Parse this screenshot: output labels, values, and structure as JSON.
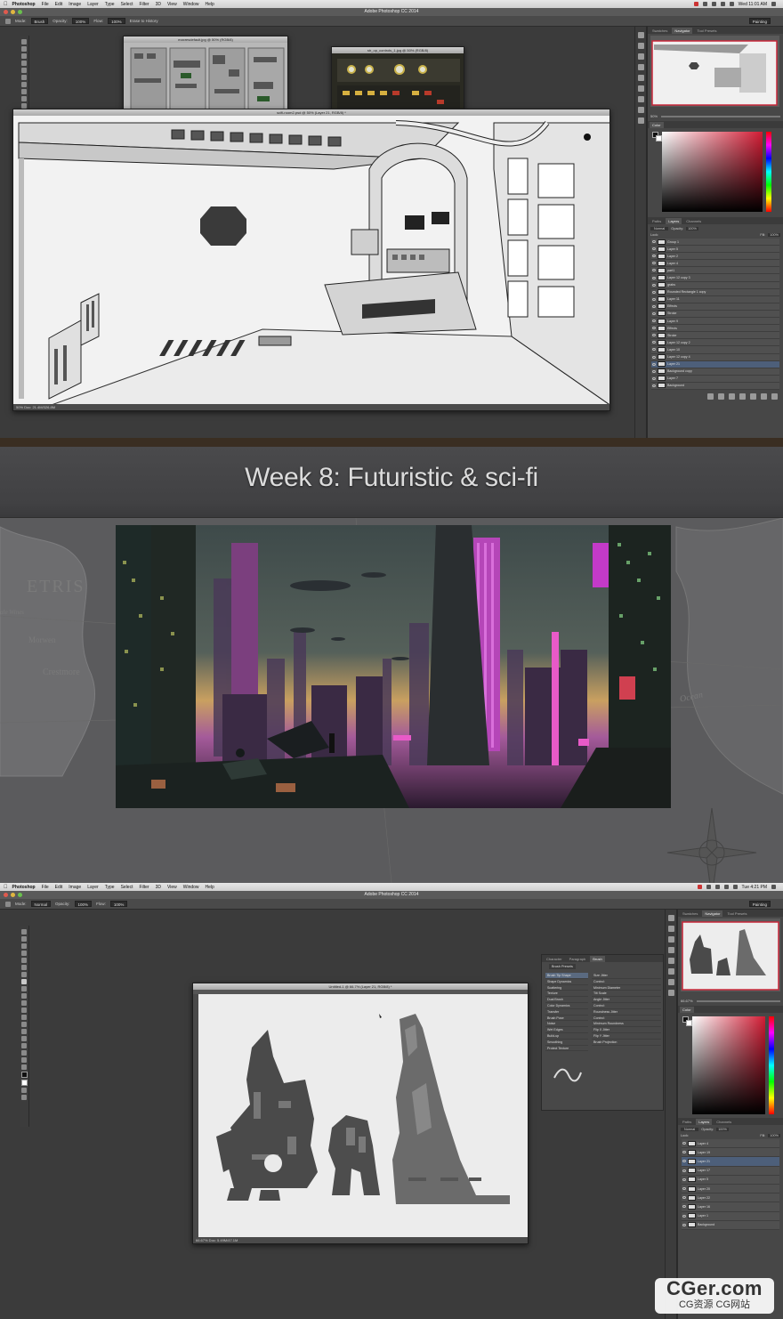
{
  "top_screen": {
    "menubar": {
      "app": "Photoshop",
      "items": [
        "File",
        "Edit",
        "Image",
        "Layer",
        "Type",
        "Select",
        "Filter",
        "3D",
        "View",
        "Window",
        "Help"
      ],
      "clock": "Wed 11:01 AM"
    },
    "window_title": "Adobe Photoshop CC 2014",
    "options": {
      "mode_label": "Mode:",
      "mode": "Brush",
      "opacity_label": "Opacity:",
      "opacity": "100%",
      "flow_label": "Flow:",
      "flow": "100%",
      "history": "Erase to History",
      "workspace": "Painting"
    },
    "doc_back1_title": "maxresdefault.jpg @ 50% (RGB/8)",
    "doc_back2_title": "str_op_controls_1.jpg @ 50% (RGB/8)",
    "doc_main_title": "scifi-room2.psd @ 50% (Layer 21, RGB/8) *",
    "doc_main_status": "50%     Doc: 21.4M/326.8M",
    "panel_tabs": [
      "Swatches",
      "Navigator",
      "Tool Presets"
    ],
    "color_tab": "Color",
    "zoom_value": "50%",
    "layers_tabs": [
      "Paths",
      "Layers",
      "Channels"
    ],
    "blend_mode": "Normal",
    "opacity_label": "Opacity:",
    "opacity_value": "100%",
    "lock_label": "Lock:",
    "fill_label": "Fill:",
    "fill_value": "100%",
    "layers": [
      "Group 1",
      "Layer 5",
      "Layer 2",
      "Layer 4",
      "part1",
      "Layer 12 copy 3",
      "grabs",
      "Rounded Rectangle 1 copy",
      "Layer 11",
      "Effects",
      "Stroke",
      "Layer 9",
      "Effects",
      "Stroke",
      "Layer 12 copy 2",
      "Layer 10",
      "Layer 12 copy 4",
      "Layer 21",
      "Background copy",
      "Layer 7",
      "Background"
    ],
    "selected_layer": "Layer 21"
  },
  "middle": {
    "headline": "Week 8: Futuristic & sci-fi",
    "map_labels": {
      "etris": "ETRIS",
      "morwen": "Morwen",
      "crestmore": "Crestmore",
      "ocean": "Ocean",
      "wines": "ale Wines"
    }
  },
  "bottom_screen": {
    "menubar": {
      "app": "Photoshop",
      "items": [
        "File",
        "Edit",
        "Image",
        "Layer",
        "Type",
        "Select",
        "Filter",
        "3D",
        "View",
        "Window",
        "Help"
      ],
      "clock": "Tue 4:21 PM"
    },
    "window_title": "Adobe Photoshop CC 2014",
    "options": {
      "mode_label": "Mode:",
      "mode": "Normal",
      "opacity_label": "Opacity:",
      "opacity": "100%",
      "flow_label": "Flow:",
      "flow": "100%",
      "workspace": "Painting"
    },
    "doc_title": "Untitled-1 @ 66.7% (Layer 21, RGB/8) *",
    "doc_status": "66.67%     Doc: 5.49M/47.1M",
    "brush_panel_tabs": [
      "Character",
      "Paragraph",
      "Brush"
    ],
    "brush_presets_button": "Brush Presets",
    "brush_options": [
      "Brush Tip Shape",
      "Shape Dynamics",
      "Scattering",
      "Texture",
      "Dual Brush",
      "Color Dynamics",
      "Transfer",
      "Brush Pose",
      "Noise",
      "Wet Edges",
      "Build-up",
      "Smoothing",
      "Protect Texture"
    ],
    "brush_settings": [
      "Size Jitter",
      "Control:",
      "Minimum Diameter",
      "Tilt Scale",
      "Angle Jitter",
      "Control:",
      "Roundness Jitter",
      "Control:",
      "Minimum Roundness",
      "Flip X Jitter",
      "Flip Y Jitter",
      "Brush Projection"
    ],
    "panel_tabs": [
      "Swatches",
      "Navigator",
      "Tool Presets"
    ],
    "color_tab": "Color",
    "zoom_value": "66.67%",
    "layers_tabs": [
      "Paths",
      "Layers",
      "Channels"
    ],
    "blend_mode": "Normal",
    "opacity_label": "Opacity:",
    "opacity_value": "100%",
    "lock_label": "Lock:",
    "fill_label": "Fill:",
    "fill_value": "100%",
    "layers": [
      "Layer 4",
      "Layer 19",
      "Layer 21",
      "Layer 17",
      "Layer 5",
      "Layer 20",
      "Layer 22",
      "Layer 16",
      "Layer 1",
      "Background"
    ],
    "selected_layer": "Layer 21"
  },
  "watermark": {
    "title": "CGer.com",
    "subtitle": "CG资源 CG网站"
  },
  "colors": {
    "ps_bg": "#3b3b3b",
    "panel": "#474747",
    "selected": "#4d5f7a",
    "accent_red": "#c8283a"
  }
}
